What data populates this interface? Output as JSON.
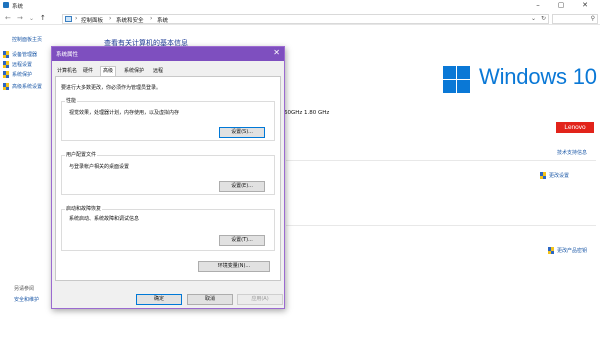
{
  "window": {
    "title": "系统",
    "minimize": "–",
    "maximize": "▢",
    "close": "✕"
  },
  "address": {
    "back": "←",
    "forward": "→",
    "recent": "⌄",
    "up": "↑",
    "crumbs": [
      "控制面板",
      "系统和安全",
      "系统"
    ],
    "separator": "›",
    "dropdown": "⌄",
    "refresh": "↻",
    "search_icon": "⚲"
  },
  "left_pane": {
    "home": "控制面板主页",
    "items": [
      "设备管理器",
      "远程设置",
      "系统保护",
      "高级系统设置"
    ],
    "see_also": "另请参阅",
    "security_maintenance": "安全和维护"
  },
  "main": {
    "heading": "查看有关计算机的基本信息",
    "windows_edition": "Windows 10",
    "cpu_freq": "60GHz   1.80 GHz",
    "manufacturer_logo": "Lenovo",
    "support_link": "技术支持信息",
    "change_settings": "更改设置",
    "change_product_key": "更改产品密钥",
    "colors": {
      "windows_blue": "#0a78d6",
      "lenovo_red": "#e2231a",
      "link": "#1e5aa8"
    }
  },
  "dialog": {
    "title": "系统属性",
    "close": "✕",
    "tabs": [
      "计算机名",
      "硬件",
      "高级",
      "系统保护",
      "远程"
    ],
    "active_tab": "高级",
    "admin_note": "要进行大多数更改，你必须作为管理员登录。",
    "performance": {
      "title": "性能",
      "desc": "视觉效果，处理器计划，内存使用，以及虚拟内存",
      "button": "设置(S)..."
    },
    "user_profiles": {
      "title": "用户配置文件",
      "desc": "与登录帐户相关的桌面设置",
      "button": "设置(E)..."
    },
    "startup_recovery": {
      "title": "启动和故障恢复",
      "desc": "系统启动、系统故障和调试信息",
      "button": "设置(T)..."
    },
    "env_button": "环境变量(N)...",
    "ok": "确定",
    "cancel": "取消",
    "apply": "应用(A)",
    "accent": "#7e4fbf"
  }
}
